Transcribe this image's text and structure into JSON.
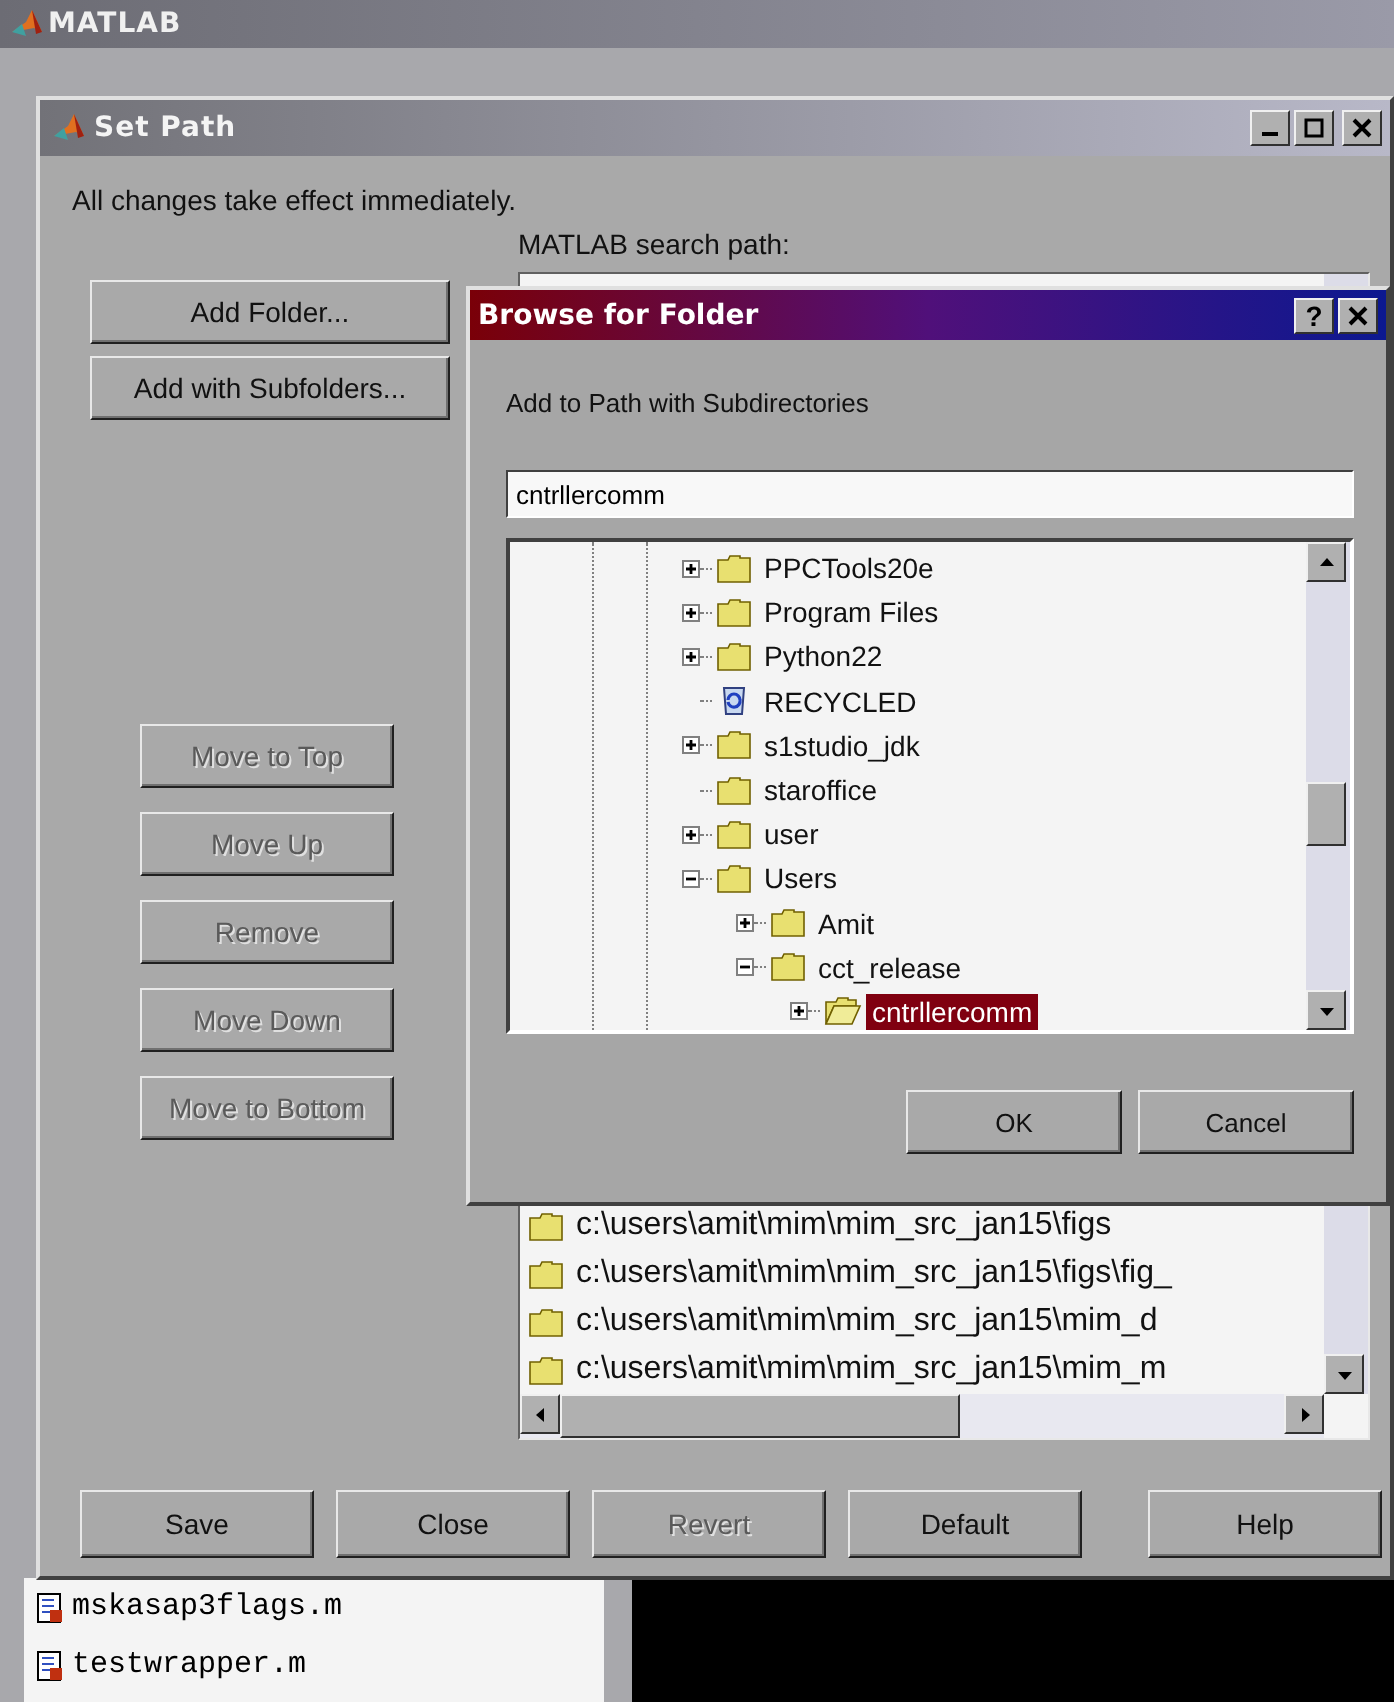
{
  "main_window": {
    "title": "MATLAB",
    "files": [
      {
        "name": "mskasap3flags.m"
      },
      {
        "name": "testwrapper.m"
      }
    ]
  },
  "set_path": {
    "title": "Set Path",
    "message": "All changes take effect immediately.",
    "add_buttons": [
      {
        "label": "Add Folder...",
        "disabled": false
      },
      {
        "label": "Add with Subfolders...",
        "disabled": false
      }
    ],
    "move_buttons": [
      {
        "label": "Move to Top",
        "disabled": true
      },
      {
        "label": "Move Up",
        "disabled": true
      },
      {
        "label": "Remove",
        "disabled": true
      },
      {
        "label": "Move Down",
        "disabled": true
      },
      {
        "label": "Move to Bottom",
        "disabled": true
      }
    ],
    "path_label": "MATLAB search path:",
    "paths": [
      "c:\\users\\amit\\mim\\mim_src_jan15\\figs",
      "c:\\users\\amit\\mim\\mim_src_jan15\\figs\\fig_",
      "c:\\users\\amit\\mim\\mim_src_jan15\\mim_d",
      "c:\\users\\amit\\mim\\mim_src_jan15\\mim_m"
    ],
    "bottom_buttons": [
      {
        "label": "Save",
        "disabled": false
      },
      {
        "label": "Close",
        "disabled": false
      },
      {
        "label": "Revert",
        "disabled": true
      },
      {
        "label": "Default",
        "disabled": false
      },
      {
        "label": "Help",
        "disabled": false
      }
    ]
  },
  "browse": {
    "title": "Browse for Folder",
    "help_button": "?",
    "prompt": "Add to Path with Subdirectories",
    "folder_field": {
      "value": "cntrllercomm"
    },
    "tree": [
      {
        "label": "PPCTools20e",
        "kind": "folder",
        "expanded": false,
        "selected": false
      },
      {
        "label": "Program Files",
        "kind": "folder",
        "expanded": false,
        "selected": false
      },
      {
        "label": "Python22",
        "kind": "folder",
        "expanded": false,
        "selected": false
      },
      {
        "label": "RECYCLED",
        "kind": "recycle-bin",
        "selected": false
      },
      {
        "label": "s1studio_jdk",
        "kind": "folder",
        "expanded": false,
        "selected": false
      },
      {
        "label": "staroffice",
        "kind": "folder",
        "selected": false
      },
      {
        "label": "user",
        "kind": "folder",
        "expanded": false,
        "selected": false
      },
      {
        "label": "Users",
        "kind": "folder",
        "expanded": true,
        "selected": false,
        "children": [
          {
            "label": "Amit",
            "kind": "folder",
            "expanded": false,
            "selected": false
          },
          {
            "label": "cct_release",
            "kind": "folder",
            "expanded": true,
            "selected": false,
            "children": [
              {
                "label": "cntrllercomm",
                "kind": "open-folder",
                "expanded": false,
                "selected": true
              }
            ]
          }
        ]
      }
    ],
    "buttons": [
      {
        "label": "OK"
      },
      {
        "label": "Cancel"
      }
    ]
  }
}
